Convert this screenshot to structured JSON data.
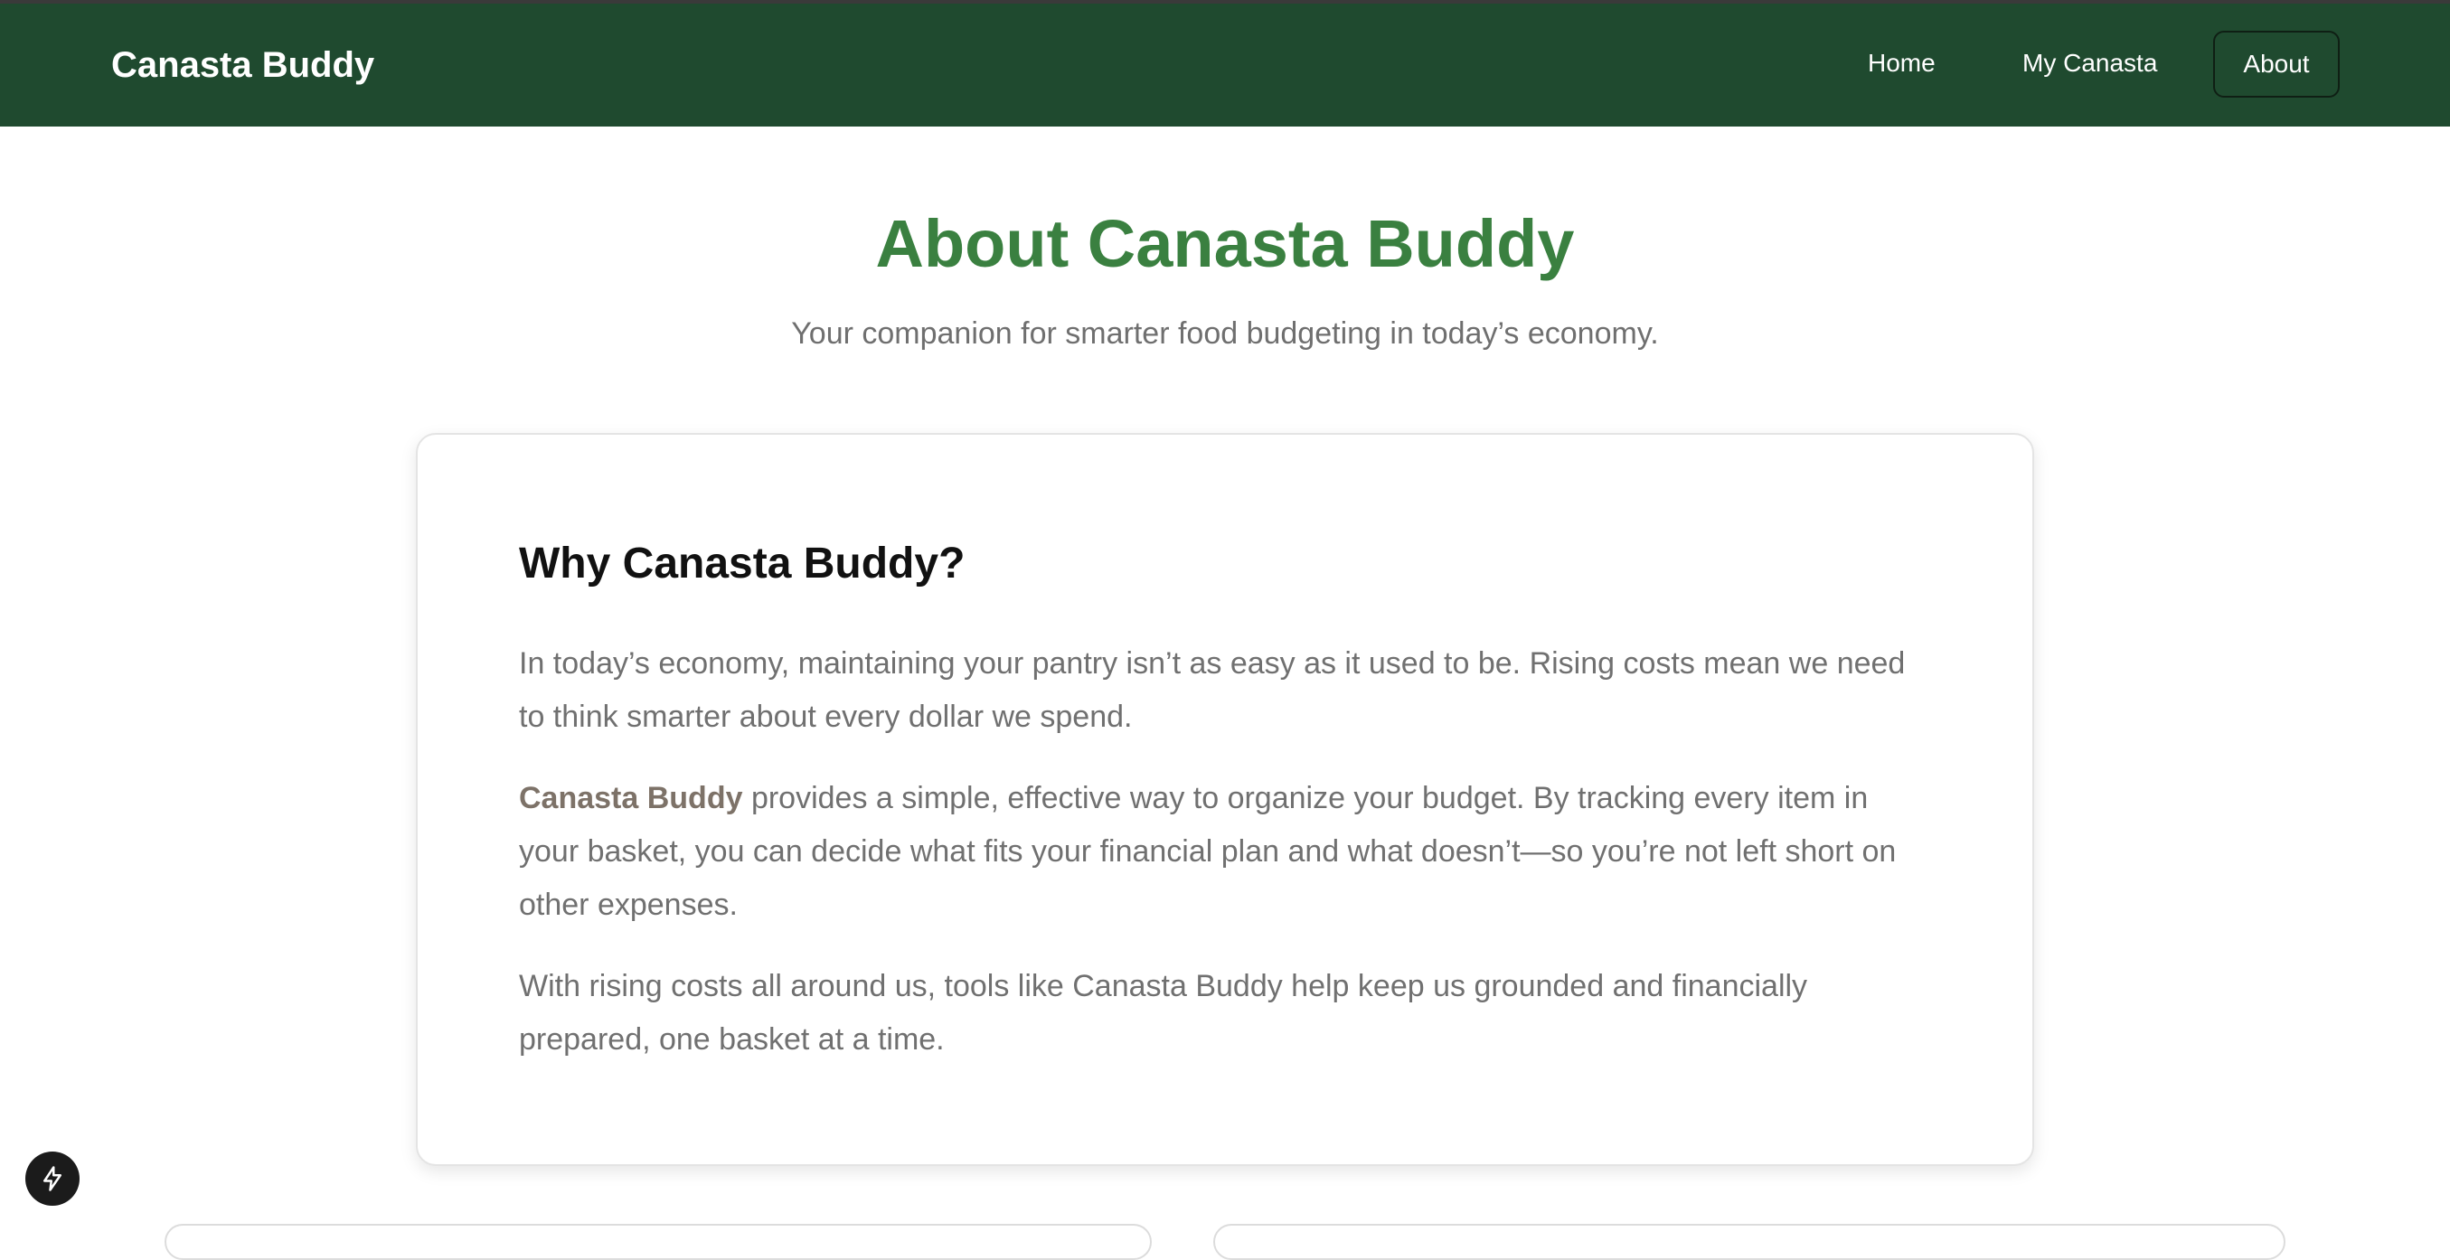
{
  "nav": {
    "brand": "Canasta Buddy",
    "links": [
      {
        "label": "Home"
      },
      {
        "label": "My Canasta"
      },
      {
        "label": "About"
      }
    ],
    "active": "About"
  },
  "hero": {
    "title": "About Canasta Buddy",
    "subtitle": "Your companion for smarter food budgeting in today’s economy."
  },
  "card": {
    "heading": "Why Canasta Buddy?",
    "paragraph1": "In today’s economy, maintaining your pantry isn’t as easy as it used to be. Rising costs mean we need to think smarter about every dollar we spend.",
    "paragraph2_bold": "Canasta Buddy",
    "paragraph2_rest": " provides a simple, effective way to organize your budget. By tracking every item in your basket, you can decide what fits your financial plan and what doesn’t—so you’re not left short on other expenses.",
    "paragraph3": "With rising costs all around us, tools like Canasta Buddy help keep us grounded and financially prepared, one basket at a time."
  },
  "floating_button": {
    "icon": "lightning-bolt-icon"
  },
  "colors": {
    "navbar_bg": "#1f4a2f",
    "title_green": "#3a8040",
    "body_text": "#707070"
  }
}
